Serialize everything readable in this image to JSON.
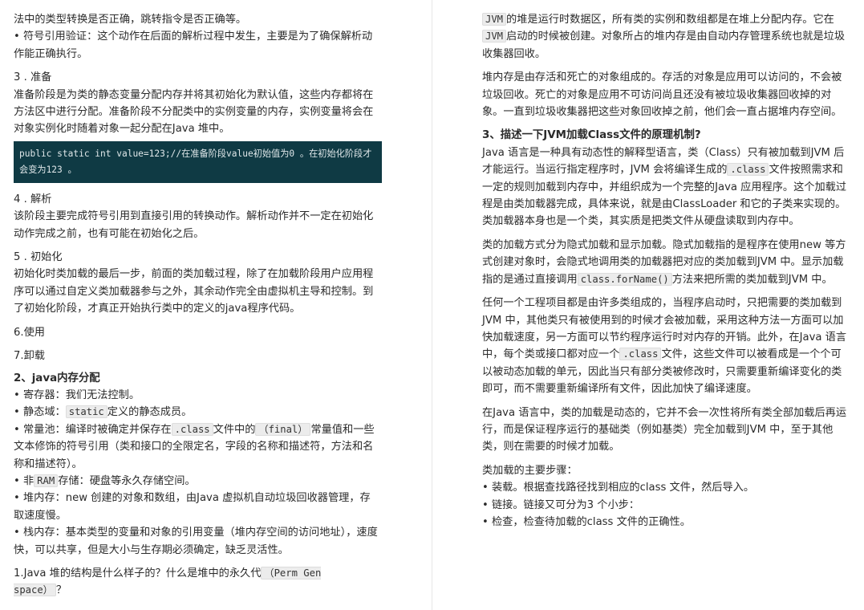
{
  "left": {
    "p1": "法中的类型转换是否正确，跳转指令是否正确等。",
    "b1": "符号引用验证：这个动作在后面的解析过程中发生，主要是为了确保解析动作能正确执行。",
    "s3_title": "3 . 准备",
    "s3_text": "准备阶段是为类的静态变量分配内存并将其初始化为默认值，这些内存都将在方法区中进行分配。准备阶段不分配类中的实例变量的内存，实例变量将会在对象实例化时随着对象一起分配在Java 堆中。",
    "code": "public static int value=123;//在准备阶段value初始值为0 。在初始化阶段才会变为123 。",
    "s4_title": "4 . 解析",
    "s4_text": "该阶段主要完成符号引用到直接引用的转换动作。解析动作并不一定在初始化动作完成之前，也有可能在初始化之后。",
    "s5_title": "5 . 初始化",
    "s5_text": "初始化时类加载的最后一步，前面的类加载过程，除了在加载阶段用户应用程序可以通过自定义类加载器参与之外，其余动作完全由虚拟机主导和控制。到了初始化阶段，才真正开始执行类中的定义的java程序代码。",
    "s6": "6.使用",
    "s7": "7.卸载",
    "h2": "2、java内存分配",
    "m1": "寄存器：我们无法控制。",
    "m2_pre": "静态域：",
    "m2_code": "static",
    "m2_post": "定义的静态成员。",
    "m3_pre": "常量池：编译时被确定并保存在",
    "m3_code1": ".class",
    "m3_mid": "文件中的",
    "m3_code2": "（final）",
    "m3_post": "常量值和一些文本修饰的符号引用（类和接口的全限定名，字段的名称和描述符，方法和名称和描述符）。",
    "m4_pre": "非",
    "m4_code": "RAM",
    "m4_post": "存储：硬盘等永久存储空间。",
    "m5": "堆内存：new 创建的对象和数组，由Java 虚拟机自动垃圾回收器管理，存取速度慢。",
    "m6": "栈内存：基本类型的变量和对象的引用变量（堆内存空间的访问地址），速度快，可以共享，但是大小与生存期必须确定，缺乏灵活性。",
    "q1_pre": "1.Java 堆的结构是什么样子的？什么是堆中的永久代",
    "q1_code": "（Perm Gen space）",
    "q1_post": "？"
  },
  "right": {
    "p1_code1": "JVM",
    "p1_a": "的堆是运行时数据区，所有类的实例和数组都是在堆上分配内存。它在",
    "p1_code2": "JVM",
    "p1_b": "启动的时候被创建。对象所占的堆内存是由自动内存管理系统也就是垃圾收集器回收。",
    "p2": "堆内存是由存活和死亡的对象组成的。存活的对象是应用可以访问的，不会被垃圾回收。死亡的对象是应用不可访问尚且还没有被垃圾收集器回收掉的对象。一直到垃圾收集器把这些对象回收掉之前，他们会一直占据堆内存空间。",
    "h3": "3、描述一下JVM加载Class文件的原理机制?",
    "p3_a": "Java 语言是一种具有动态性的解释型语言，类（Class）只有被加载到JVM 后才能运行。当运行指定程序时，JVM 会将编译生成的",
    "p3_code": ".class",
    "p3_b": "文件按照需求和一定的规则加载到内存中，并组织成为一个完整的Java 应用程序。这个加载过程是由类加载器完成，具体来说，就是由ClassLoader 和它的子类来实现的。类加载器本身也是一个类，其实质是把类文件从硬盘读取到内存中。",
    "p4_a": "类的加载方式分为隐式加载和显示加载。隐式加载指的是程序在使用new 等方式创建对象时，会隐式地调用类的加载器把对应的类加载到JVM 中。显示加载指的是通过直接调用",
    "p4_code": "class.forName()",
    "p4_b": "方法来把所需的类加载到JVM 中。",
    "p5_a": "任何一个工程项目都是由许多类组成的，当程序启动时，只把需要的类加载到JVM 中，其他类只有被使用到的时候才会被加载，采用这种方法一方面可以加快加载速度，另一方面可以节约程序运行时对内存的开销。此外，在Java 语言中，每个类或接口都对应一个",
    "p5_code": ".class",
    "p5_b": "文件，这些文件可以被看成是一个个可以被动态加载的单元，因此当只有部分类被修改时，只需要重新编译变化的类即可，而不需要重新编译所有文件，因此加快了编译速度。",
    "p6": "在Java 语言中，类的加载是动态的，它并不会一次性将所有类全部加载后再运行，而是保证程序运行的基础类（例如基类）完全加载到JVM 中，至于其他类，则在需要的时候才加载。",
    "p7": "类加载的主要步骤：",
    "s1": "装载。根据查找路径找到相应的class 文件，然后导入。",
    "s2": "链接。链接又可分为3 个小步：",
    "s3": "检查，检查待加载的class 文件的正确性。"
  }
}
